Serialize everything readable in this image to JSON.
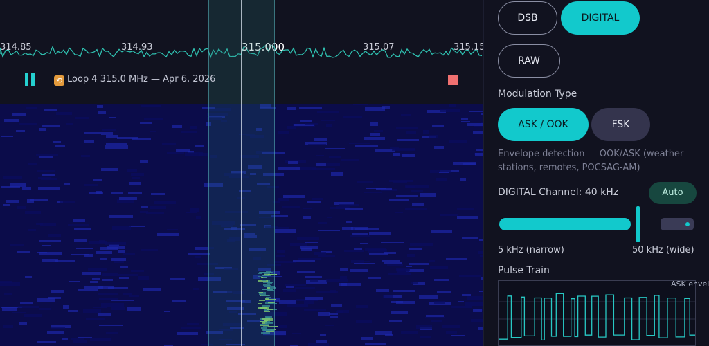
{
  "spectrum": {
    "freq_labels": [
      "314.85",
      "314.93",
      "315.000",
      "315.07",
      "315.15"
    ],
    "center_frequency": "315.000"
  },
  "playback": {
    "title": "Loop 4  315.0 MHz — Apr 6, 2026",
    "loop_icon": "loop-icon",
    "pause_icon": "pause-icon",
    "stop_icon": "stop-icon"
  },
  "demod": {
    "modes": [
      "DSB",
      "DIGITAL",
      "RAW"
    ],
    "selected_mode": "DIGITAL"
  },
  "modulation": {
    "heading": "Modulation Type",
    "options": [
      "ASK / OOK",
      "FSK"
    ],
    "selected": "ASK / OOK",
    "description": "Envelope detection — OOK/ASK (weather stations, remotes, POCSAG-AM)"
  },
  "channel": {
    "label": "DIGITAL Channel: 40 kHz",
    "auto_label": "Auto",
    "min_label": "5 kHz (narrow)",
    "max_label": "50 kHz (wide)",
    "value_khz": 40,
    "min_khz": 5,
    "max_khz": 50
  },
  "pulse": {
    "heading": "Pulse Train",
    "legend": "ASK envelope"
  },
  "colors": {
    "accent": "#12c9cc",
    "background": "#0d0e1a",
    "stop": "#f07070"
  }
}
